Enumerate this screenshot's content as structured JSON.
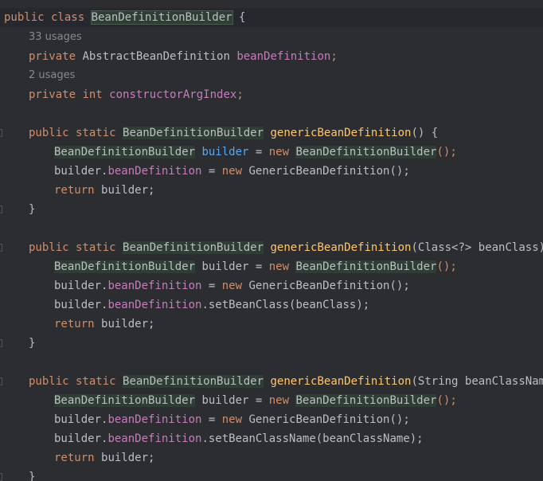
{
  "code": {
    "class_decl": {
      "kw": "public class ",
      "name": "BeanDefinitionBuilder",
      "tail": " {"
    },
    "usages1": "33 usages",
    "field1": {
      "mod": "private ",
      "type": "AbstractBeanDefinition ",
      "name": "beanDefinition",
      "semi": ";"
    },
    "usages2": "2 usages",
    "field2": {
      "mod": "private ",
      "type": "int ",
      "name": "constructorArgIndex",
      "semi": ";"
    },
    "method1": {
      "sig": {
        "mods": "public static ",
        "type": "BeanDefinitionBuilder",
        "sp": " ",
        "name": "genericBeanDefinition",
        "params": "() {"
      },
      "l1": {
        "type": "BeanDefinitionBuilder",
        "var": " builder",
        "eq": " = ",
        "new": "new ",
        "ctor": "BeanDefinitionBuilder",
        "end": "();"
      },
      "l2": {
        "obj": "builder.",
        "field": "beanDefinition",
        "eq": " = ",
        "new": "new ",
        "rest": "GenericBeanDefinition();"
      },
      "l3": {
        "ret": "return ",
        "rest": "builder;"
      },
      "close": "}"
    },
    "method2": {
      "sig": {
        "mods": "public static ",
        "type": "BeanDefinitionBuilder",
        "sp": " ",
        "name": "genericBeanDefinition",
        "params": "(Class<?> beanClass) {"
      },
      "l1": {
        "type": "BeanDefinitionBuilder",
        "var": " builder",
        "eq": " = ",
        "new": "new ",
        "ctor": "BeanDefinitionBuilder",
        "end": "();"
      },
      "l2": {
        "obj": "builder.",
        "field": "beanDefinition",
        "eq": " = ",
        "new": "new ",
        "rest": "GenericBeanDefinition();"
      },
      "l3": {
        "obj": "builder.",
        "field": "beanDefinition",
        "rest": ".setBeanClass(beanClass);"
      },
      "l4": {
        "ret": "return ",
        "rest": "builder;"
      },
      "close": "}"
    },
    "method3": {
      "sig": {
        "mods": "public static ",
        "type": "BeanDefinitionBuilder",
        "sp": " ",
        "name": "genericBeanDefinition",
        "params": "(String beanClassName) {"
      },
      "l1": {
        "type": "BeanDefinitionBuilder",
        "var": " builder",
        "eq": " = ",
        "new": "new ",
        "ctor": "BeanDefinitionBuilder",
        "end": "();"
      },
      "l2": {
        "obj": "builder.",
        "field": "beanDefinition",
        "eq": " = ",
        "new": "new ",
        "rest": "GenericBeanDefinition();"
      },
      "l3": {
        "obj": "builder.",
        "field": "beanDefinition",
        "rest": ".setBeanClassName(beanClassName);"
      },
      "l4": {
        "ret": "return ",
        "rest": "builder;"
      },
      "close": "}"
    }
  }
}
